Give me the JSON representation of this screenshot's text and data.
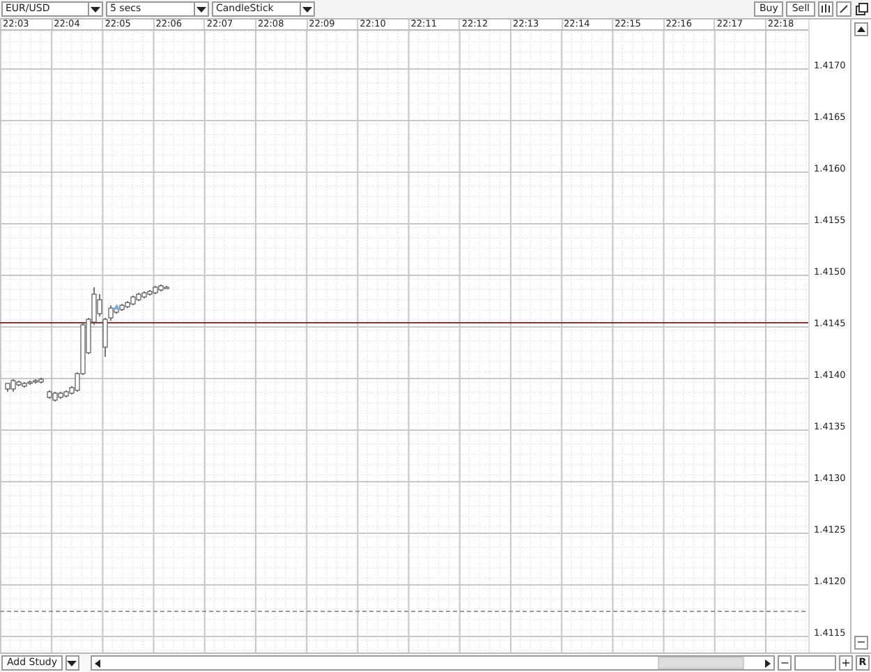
{
  "toolbar": {
    "symbol": "EUR/USD",
    "interval": "5 secs",
    "chart_type": "CandleStick",
    "buttons": [
      "Buy",
      "Sell"
    ]
  },
  "time_axis": [
    "22:03",
    "22:04",
    "22:05",
    "22:06",
    "22:07",
    "22:08",
    "22:09",
    "22:10",
    "22:11",
    "22:12",
    "22:13",
    "22:14",
    "22:15",
    "22:16",
    "22:17",
    "22:18"
  ],
  "price_axis": [
    "1.4170",
    "1.4165",
    "1.4160",
    "1.4155",
    "1.4150",
    "1.4145",
    "1.4140",
    "1.4135",
    "1.4130",
    "1.4125",
    "1.4120",
    "1.4115"
  ],
  "side_scroller": {
    "zoom_out": "−"
  },
  "bottom_bar": {
    "add_study": "Add Study",
    "zoom_out": "−",
    "zoom_in": "+",
    "reset": "R"
  }
}
